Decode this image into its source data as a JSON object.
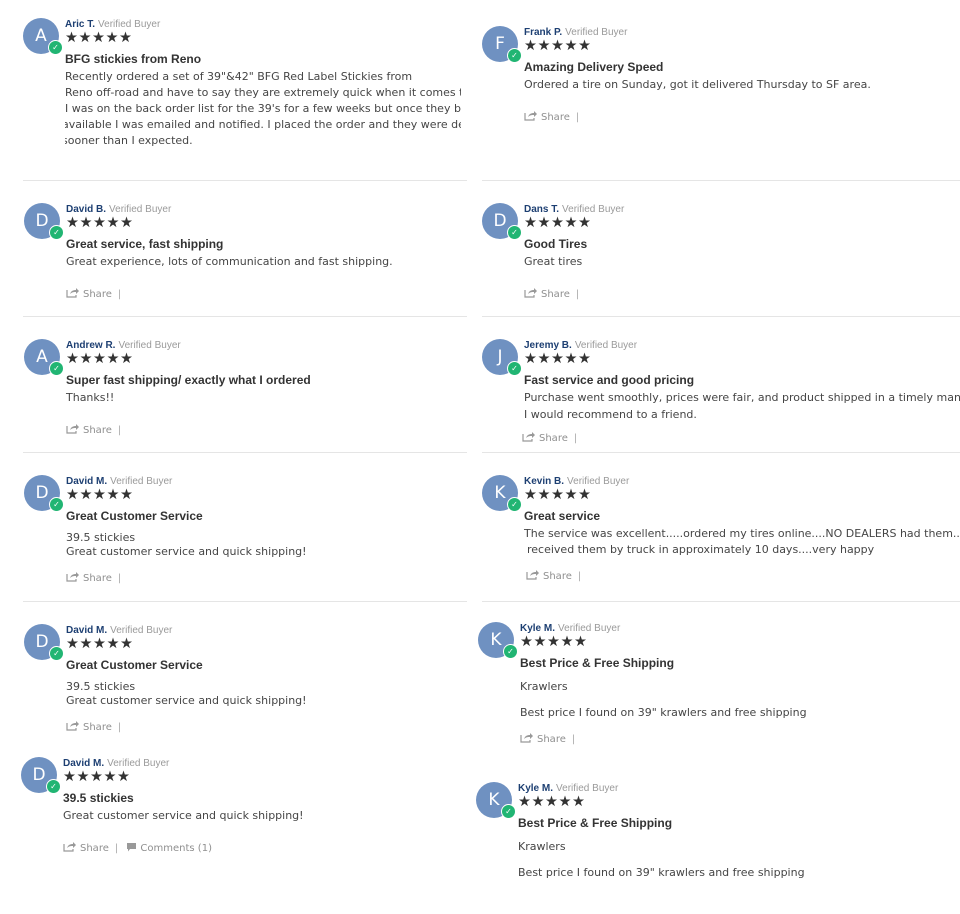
{
  "common": {
    "verified": "Verified Buyer",
    "stars": "★★★★★",
    "share": "Share",
    "pipe": "|",
    "check": "✓"
  },
  "reviews": [
    {
      "initial": "A",
      "name": "Aric T.",
      "title": "BFG stickies from Reno",
      "body": [
        "Recently ordered a set of 39\"&42\" BFG Red Label Stickies from",
        "Reno off-road and have to say  they are extremely quick when it comes to deliver",
        "I was on the back order list for the 39's for a few weeks but once they became",
        "available I was emailed and notified. I placed the order and they were delivered",
        "sooner than I expected."
      ]
    },
    {
      "initial": "F",
      "name": "Frank P.",
      "title": "Amazing Delivery Speed",
      "body": [
        "Ordered a tire on Sunday, got it delivered Thursday to SF area."
      ]
    },
    {
      "initial": "D",
      "name": "David B.",
      "title": "Great service, fast shipping",
      "body": [
        "Great experience, lots of communication and fast shipping."
      ]
    },
    {
      "initial": "D",
      "name": "Dans T.",
      "title": "Good Tires",
      "body": [
        "Great tires"
      ]
    },
    {
      "initial": "A",
      "name": "Andrew R.",
      "title": "Super fast shipping/ exactly what I ordered",
      "body": [
        "Thanks!!"
      ]
    },
    {
      "initial": "J",
      "name": "Jeremy B.",
      "title": "Fast service and good pricing",
      "body": [
        "Purchase went smoothly, prices were fair, and product shipped in a timely manner.",
        "I would recommend to a friend."
      ]
    },
    {
      "initial": "D",
      "name": "David M.",
      "title": "Great Customer Service",
      "body": [
        "39.5 stickies",
        "Great customer service and quick shipping!"
      ]
    },
    {
      "initial": "K",
      "name": "Kevin B.",
      "title": "Great service",
      "body": [
        "The service was excellent.....ordered my tires online....NO DEALERS had them....",
        "received them by truck in approximately 10 days....very happy"
      ]
    },
    {
      "initial": "D",
      "name": "David M.",
      "title": "Great Customer Service",
      "body": [
        "39.5 stickies",
        "Great customer service and quick shipping!"
      ]
    },
    {
      "initial": "K",
      "name": "Kyle M.",
      "title": "Best Price & Free Shipping",
      "body": [
        "Krawlers",
        "",
        "Best price I found on 39\" krawlers and free shipping"
      ]
    },
    {
      "initial": "D",
      "name": "David M.",
      "title": "39.5 stickies",
      "body": [
        "Great customer service and quick shipping!"
      ],
      "comments": "Comments (1)"
    },
    {
      "initial": "K",
      "name": "Kyle M.",
      "title": "Best Price & Free Shipping",
      "body": [
        "Krawlers",
        "",
        "Best price I found on 39\" krawlers and free shipping"
      ]
    }
  ]
}
